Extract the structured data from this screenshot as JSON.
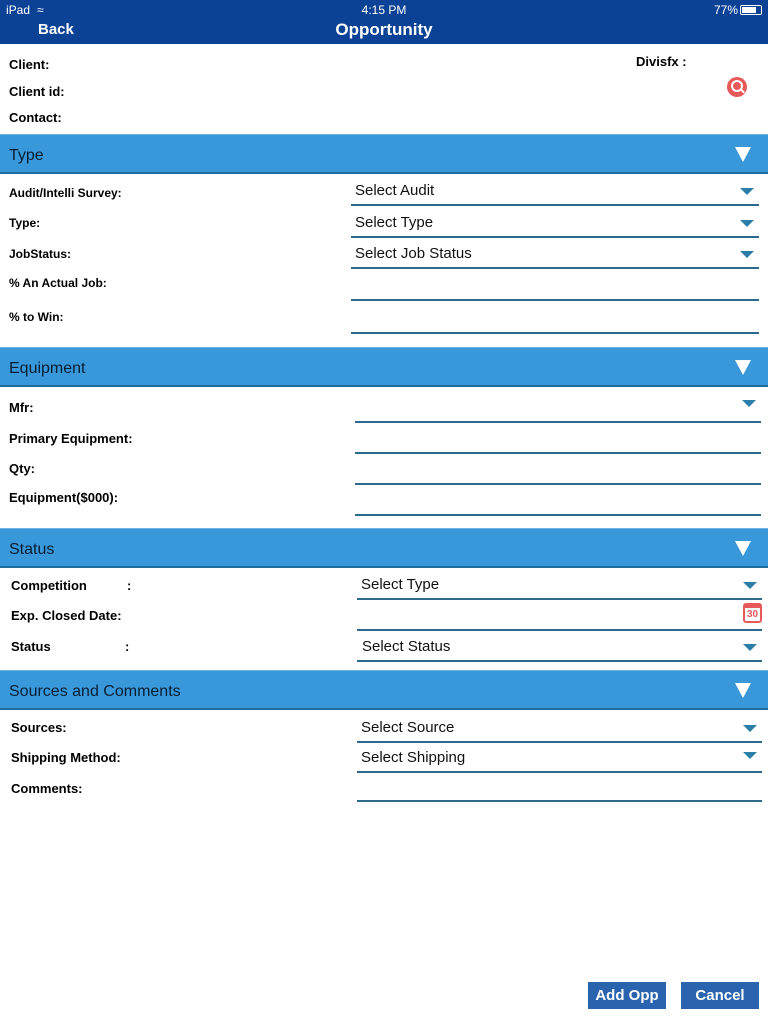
{
  "status_bar": {
    "device": "iPad",
    "time": "4:15 PM",
    "battery": "77%"
  },
  "nav": {
    "back": "Back",
    "title": "Opportunity"
  },
  "client": {
    "client_label": "Client:",
    "client_id_label": "Client id:",
    "contact_label": "Contact:",
    "divisfx_label": "Divisfx :"
  },
  "sections": {
    "type": {
      "title": "Type",
      "audit_label": "Audit/Intelli Survey:",
      "audit_value": "Select Audit",
      "type_label": "Type:",
      "type_value": "Select Type",
      "jobstatus_label": "JobStatus:",
      "jobstatus_value": "Select Job Status",
      "actual_label": "% An Actual Job:",
      "win_label": "% to Win:"
    },
    "equipment": {
      "title": "Equipment",
      "mfr_label": "Mfr:",
      "primary_label": "Primary Equipment:",
      "qty_label": "Qty:",
      "equip_label": "Equipment($000):"
    },
    "status": {
      "title": "Status",
      "competition_label": "Competition",
      "colon": ":",
      "competition_value": "Select Type",
      "closed_label": "Exp. Closed Date:",
      "calendar_day": "30",
      "status_label": "Status",
      "status_value": "Select Status"
    },
    "sources": {
      "title": "Sources and Comments",
      "sources_label": "Sources:",
      "sources_value": "Select Source",
      "shipping_label": "Shipping Method:",
      "shipping_value": "Select Shipping",
      "comments_label": "Comments:"
    }
  },
  "buttons": {
    "add": "Add Opp",
    "cancel": "Cancel"
  },
  "colors": {
    "nav": "#0b4296",
    "section": "#3898da",
    "button": "#2b64ae",
    "accent": "#e85a5a"
  }
}
